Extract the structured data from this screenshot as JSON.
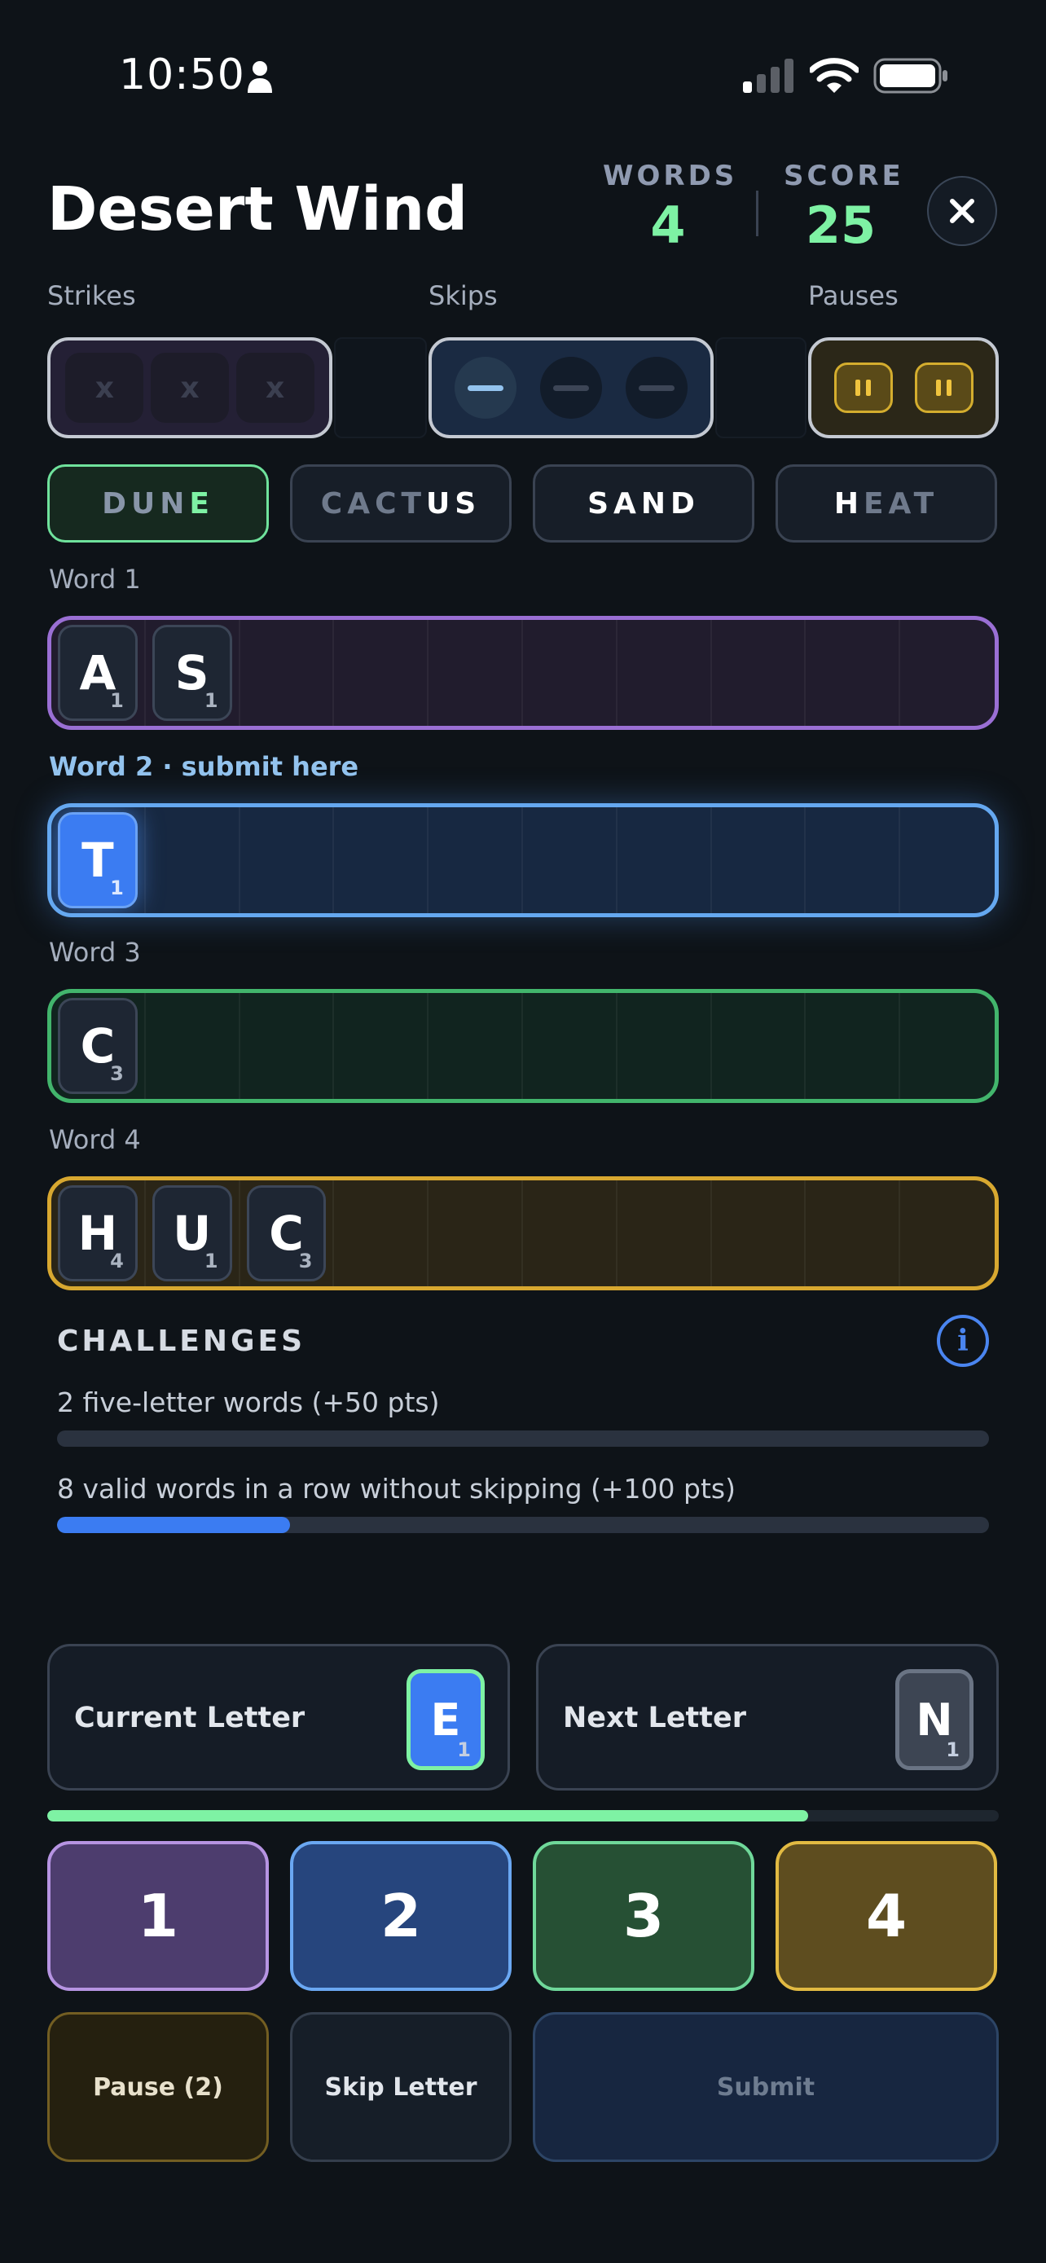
{
  "status_bar": {
    "time": "10:50"
  },
  "header": {
    "title": "Desert Wind",
    "words_label": "WORDS",
    "words_value": "4",
    "score_label": "SCORE",
    "score_value": "25"
  },
  "counters": {
    "strikes_label": "Strikes",
    "skips_label": "Skips",
    "pauses_label": "Pauses",
    "strike_glyph": "x",
    "strikes_total": 3,
    "skips_total": 3,
    "skips_used": 1,
    "pauses_total": 2
  },
  "chips": [
    {
      "prefix": "DUN",
      "highlight": "E",
      "suffix": ""
    },
    {
      "prefix": "CACT",
      "highlight": "US",
      "suffix": ""
    },
    {
      "prefix": "SAND",
      "highlight": "",
      "suffix": ""
    },
    {
      "prefix": "",
      "highlight": "H",
      "suffix": "EAT"
    }
  ],
  "words": [
    {
      "label": "Word 1",
      "tiles": [
        {
          "letter": "A",
          "points": "1"
        },
        {
          "letter": "S",
          "points": "1"
        }
      ]
    },
    {
      "label": "Word 2 · submit here",
      "tiles": [
        {
          "letter": "T",
          "points": "1"
        }
      ]
    },
    {
      "label": "Word 3",
      "tiles": [
        {
          "letter": "C",
          "points": "3"
        }
      ]
    },
    {
      "label": "Word 4",
      "tiles": [
        {
          "letter": "H",
          "points": "4"
        },
        {
          "letter": "U",
          "points": "1"
        },
        {
          "letter": "C",
          "points": "3"
        }
      ]
    }
  ],
  "challenges": {
    "title": "CHALLENGES",
    "info_glyph": "i",
    "items": [
      {
        "text": "2 five-letter words (+50 pts)",
        "progress": 0
      },
      {
        "text": "8 valid words in a row without skipping (+100 pts)",
        "progress": 0.25
      }
    ]
  },
  "current_letter": {
    "label": "Current Letter",
    "letter": "E",
    "points": "1"
  },
  "next_letter": {
    "label": "Next Letter",
    "letter": "N",
    "points": "1"
  },
  "timer_progress": 0.8,
  "number_buttons": [
    "1",
    "2",
    "3",
    "4"
  ],
  "actions": {
    "pause_label": "Pause (2)",
    "skip_label": "Skip Letter",
    "submit_label": "Submit"
  },
  "colors": {
    "accent_green": "#7ef2a4",
    "accent_blue": "#3b7cf2",
    "row1": "#9a6fd4",
    "row2": "#65a8f0",
    "row3": "#42b56c",
    "row4": "#d8a830"
  }
}
